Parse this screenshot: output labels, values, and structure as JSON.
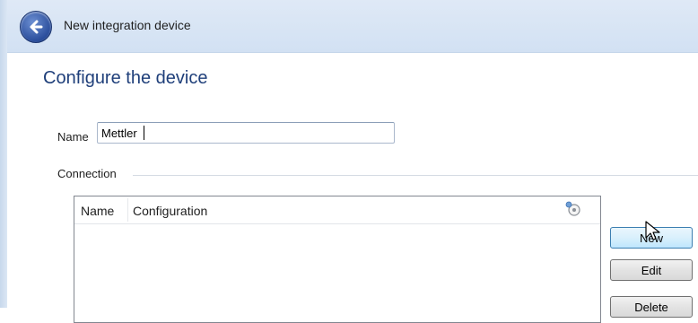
{
  "window": {
    "title": "New integration device"
  },
  "page": {
    "heading": "Configure the device"
  },
  "form": {
    "name_label": "Name",
    "name_value": "Mettler",
    "connection_label": "Connection"
  },
  "list": {
    "columns": [
      "Name",
      "Configuration"
    ]
  },
  "buttons": {
    "new": "New",
    "edit": "Edit",
    "delete": "Delete"
  },
  "icons": {
    "back": "back-arrow-icon",
    "column_options": "column-options-icon",
    "pointer": "mouse-pointer-icon"
  }
}
